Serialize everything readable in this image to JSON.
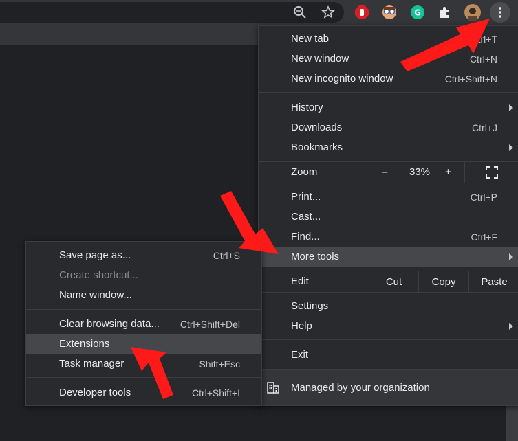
{
  "toolbar": {
    "icons": [
      "zoom-icon",
      "star-icon",
      "adblock-icon",
      "glasses-extension-icon",
      "grammarly-icon",
      "puzzle-icon",
      "avatar",
      "kebab-menu-icon"
    ]
  },
  "main_menu": {
    "new_tab": {
      "label": "New tab",
      "shortcut": "Ctrl+T"
    },
    "new_window": {
      "label": "New window",
      "shortcut": "Ctrl+N"
    },
    "new_incognito": {
      "label": "New incognito window",
      "shortcut": "Ctrl+Shift+N"
    },
    "history": {
      "label": "History"
    },
    "downloads": {
      "label": "Downloads",
      "shortcut": "Ctrl+J"
    },
    "bookmarks": {
      "label": "Bookmarks"
    },
    "zoom": {
      "label": "Zoom",
      "minus": "–",
      "value": "33%",
      "plus": "+"
    },
    "print": {
      "label": "Print...",
      "shortcut": "Ctrl+P"
    },
    "cast": {
      "label": "Cast..."
    },
    "find": {
      "label": "Find...",
      "shortcut": "Ctrl+F"
    },
    "more_tools": {
      "label": "More tools"
    },
    "edit": {
      "label": "Edit",
      "cut": "Cut",
      "copy": "Copy",
      "paste": "Paste"
    },
    "settings": {
      "label": "Settings"
    },
    "help": {
      "label": "Help"
    },
    "exit": {
      "label": "Exit"
    },
    "managed": {
      "label": "Managed by your organization"
    }
  },
  "sub_menu": {
    "save_page": {
      "label": "Save page as...",
      "shortcut": "Ctrl+S"
    },
    "create_shortcut": {
      "label": "Create shortcut..."
    },
    "name_window": {
      "label": "Name window..."
    },
    "clear_data": {
      "label": "Clear browsing data...",
      "shortcut": "Ctrl+Shift+Del"
    },
    "extensions": {
      "label": "Extensions"
    },
    "task_manager": {
      "label": "Task manager",
      "shortcut": "Shift+Esc"
    },
    "dev_tools": {
      "label": "Developer tools",
      "shortcut": "Ctrl+Shift+I"
    }
  },
  "colors": {
    "menu_bg": "#292a2d",
    "highlight": "#46474b",
    "annotation_arrow": "#ff1a1a"
  }
}
